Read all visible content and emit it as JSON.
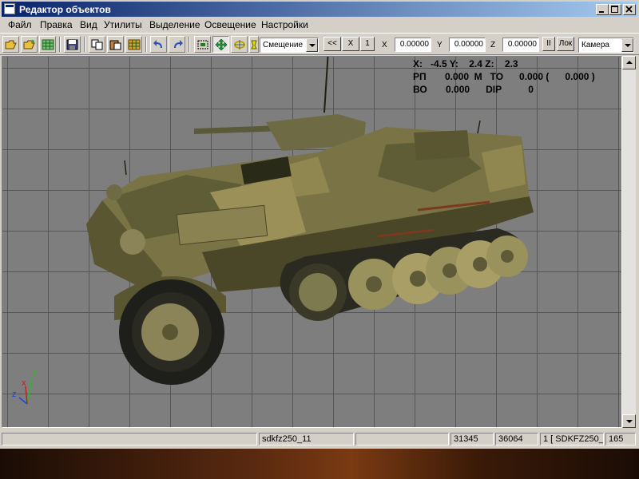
{
  "window": {
    "title": "Редактор объектов"
  },
  "menu": [
    "Файл",
    "Правка",
    "Вид",
    "Утилиты",
    "Выделение",
    "Освещение",
    "Настройки"
  ],
  "toolbar": {
    "mode_select": "Смещение",
    "step_buttons": [
      "<<",
      "X",
      "1"
    ],
    "axis_labels": [
      "X",
      "Y",
      "Z"
    ],
    "coords": [
      "0.00000",
      "0.00000",
      "0.00000"
    ],
    "pause_label": "II",
    "local_label": "Лок",
    "camera_select": "Камера",
    "icons": [
      "open-folder-icon",
      "open-folder-icon",
      "grid-icon",
      "save-icon",
      "copy-icon",
      "paste-icon",
      "grid-icon",
      "undo-icon",
      "redo-icon",
      "select-icon",
      "move-icon",
      "rotate-icon",
      "light-icon"
    ]
  },
  "info": {
    "row1": "X:   -4.5 Y:    2.4 Z:    2.3",
    "row2": "РП       0.000  M   ТО      0.000 (      0.000 )",
    "row3": "ВО       0.000      DIP          0"
  },
  "axes": {
    "y": "y",
    "x": "x",
    "z": "z"
  },
  "status": {
    "cells": [
      "",
      "sdkfz250_11",
      "",
      "31345",
      "36064",
      "1 [ SDKFZ250_",
      "165"
    ]
  },
  "colors": {
    "title_from": "#0a246a",
    "title_to": "#a6caf0",
    "viewport": "#7e7e7e",
    "grid": "#565656"
  }
}
